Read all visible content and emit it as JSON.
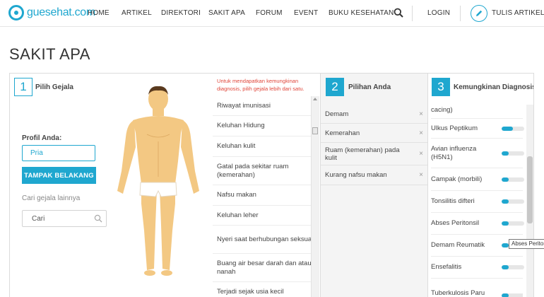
{
  "brand": {
    "logo_text": "guesehat.com",
    "accent": "#1fa7cf"
  },
  "nav": {
    "items": [
      "HOME",
      "ARTIKEL",
      "DIREKTORI",
      "SAKIT APA",
      "FORUM",
      "EVENT",
      "BUKU KESEHATAN"
    ],
    "login": "LOGIN",
    "write": "TULIS ARTIKEL"
  },
  "page": {
    "title": "SAKIT APA"
  },
  "step1": {
    "num": "1",
    "title": "Pilih Gejala",
    "profile_label": "Profil Anda:",
    "gender_value": "Pria",
    "back_button": "TAMPAK BELAKANG",
    "other_label": "Cari gejala lainnya",
    "search_placeholder": "Cari"
  },
  "symptoms": {
    "hint": "Untuk mendapatkan kemungkinan diagnosis, pilih gejala lebih dari satu.",
    "items": [
      "Riwayat imunisasi",
      "Keluhan Hidung",
      "Keluhan kulit",
      "Gatal pada sekitar ruam (kemerahan)",
      "Nafsu makan",
      "Keluhan leher",
      "Nyeri saat berhubungan seksual",
      "Buang air besar darah dan atau nanah",
      "Terjadi sejak usia kecil"
    ]
  },
  "step2": {
    "num": "2",
    "title": "Pilihan Anda",
    "remove_symbol": "×",
    "items": [
      "Demam",
      "Kemerahan",
      "Ruam (kemerahan) pada kulit",
      "Kurang nafsu makan"
    ]
  },
  "step3": {
    "num": "3",
    "title": "Kemungkinan Diagnosis",
    "partial_top": "cacing)",
    "items": [
      {
        "name": "Ulkus Peptikum",
        "level": 0.5
      },
      {
        "name": "Avian influenza (H5N1)",
        "level": 0.3
      },
      {
        "name": "Campak (morbili)",
        "level": 0.3
      },
      {
        "name": "Tonsilitis difteri",
        "level": 0.3
      },
      {
        "name": "Abses Peritonsil",
        "level": 0.3
      },
      {
        "name": "Demam Reumatik",
        "level": 0.3
      },
      {
        "name": "Ensefalitis",
        "level": 0.3
      },
      {
        "name": "Tuberkulosis Paru",
        "level": 0.3
      }
    ],
    "tooltip": "Abses Peritonsil"
  }
}
